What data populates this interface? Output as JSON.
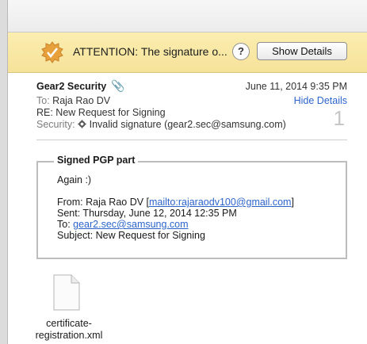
{
  "banner": {
    "text": "ATTENTION: The signature o...",
    "help_label": "?",
    "button_label": "Show Details"
  },
  "header": {
    "from": "Gear2 Security",
    "date": "June 11, 2014  9:35 PM",
    "to_label": "To:",
    "to_value": "Raja Rao DV",
    "subject": "RE: New Request for Signing",
    "security_label": "Security:",
    "security_value": "Invalid signature (gear2.sec@samsung.com)",
    "hide_details": "Hide Details",
    "count": "1"
  },
  "pgp": {
    "title": "Signed PGP part",
    "greeting": "Again :)",
    "from_prefix": "From: Raja Rao DV [",
    "from_link": "mailto:rajaraodv100@gmail.com",
    "from_suffix": "]",
    "sent": "Sent: Thursday, June 12, 2014 12:35 PM",
    "to_prefix": "To: ",
    "to_link": "gear2.sec@samsung.com",
    "subject": "Subject: New Request for Signing"
  },
  "attachment": {
    "name_line1": "certificate-",
    "name_line2": "registration.xml"
  },
  "colors": {
    "banner": "#f6e29a",
    "link": "#2c64cc"
  }
}
